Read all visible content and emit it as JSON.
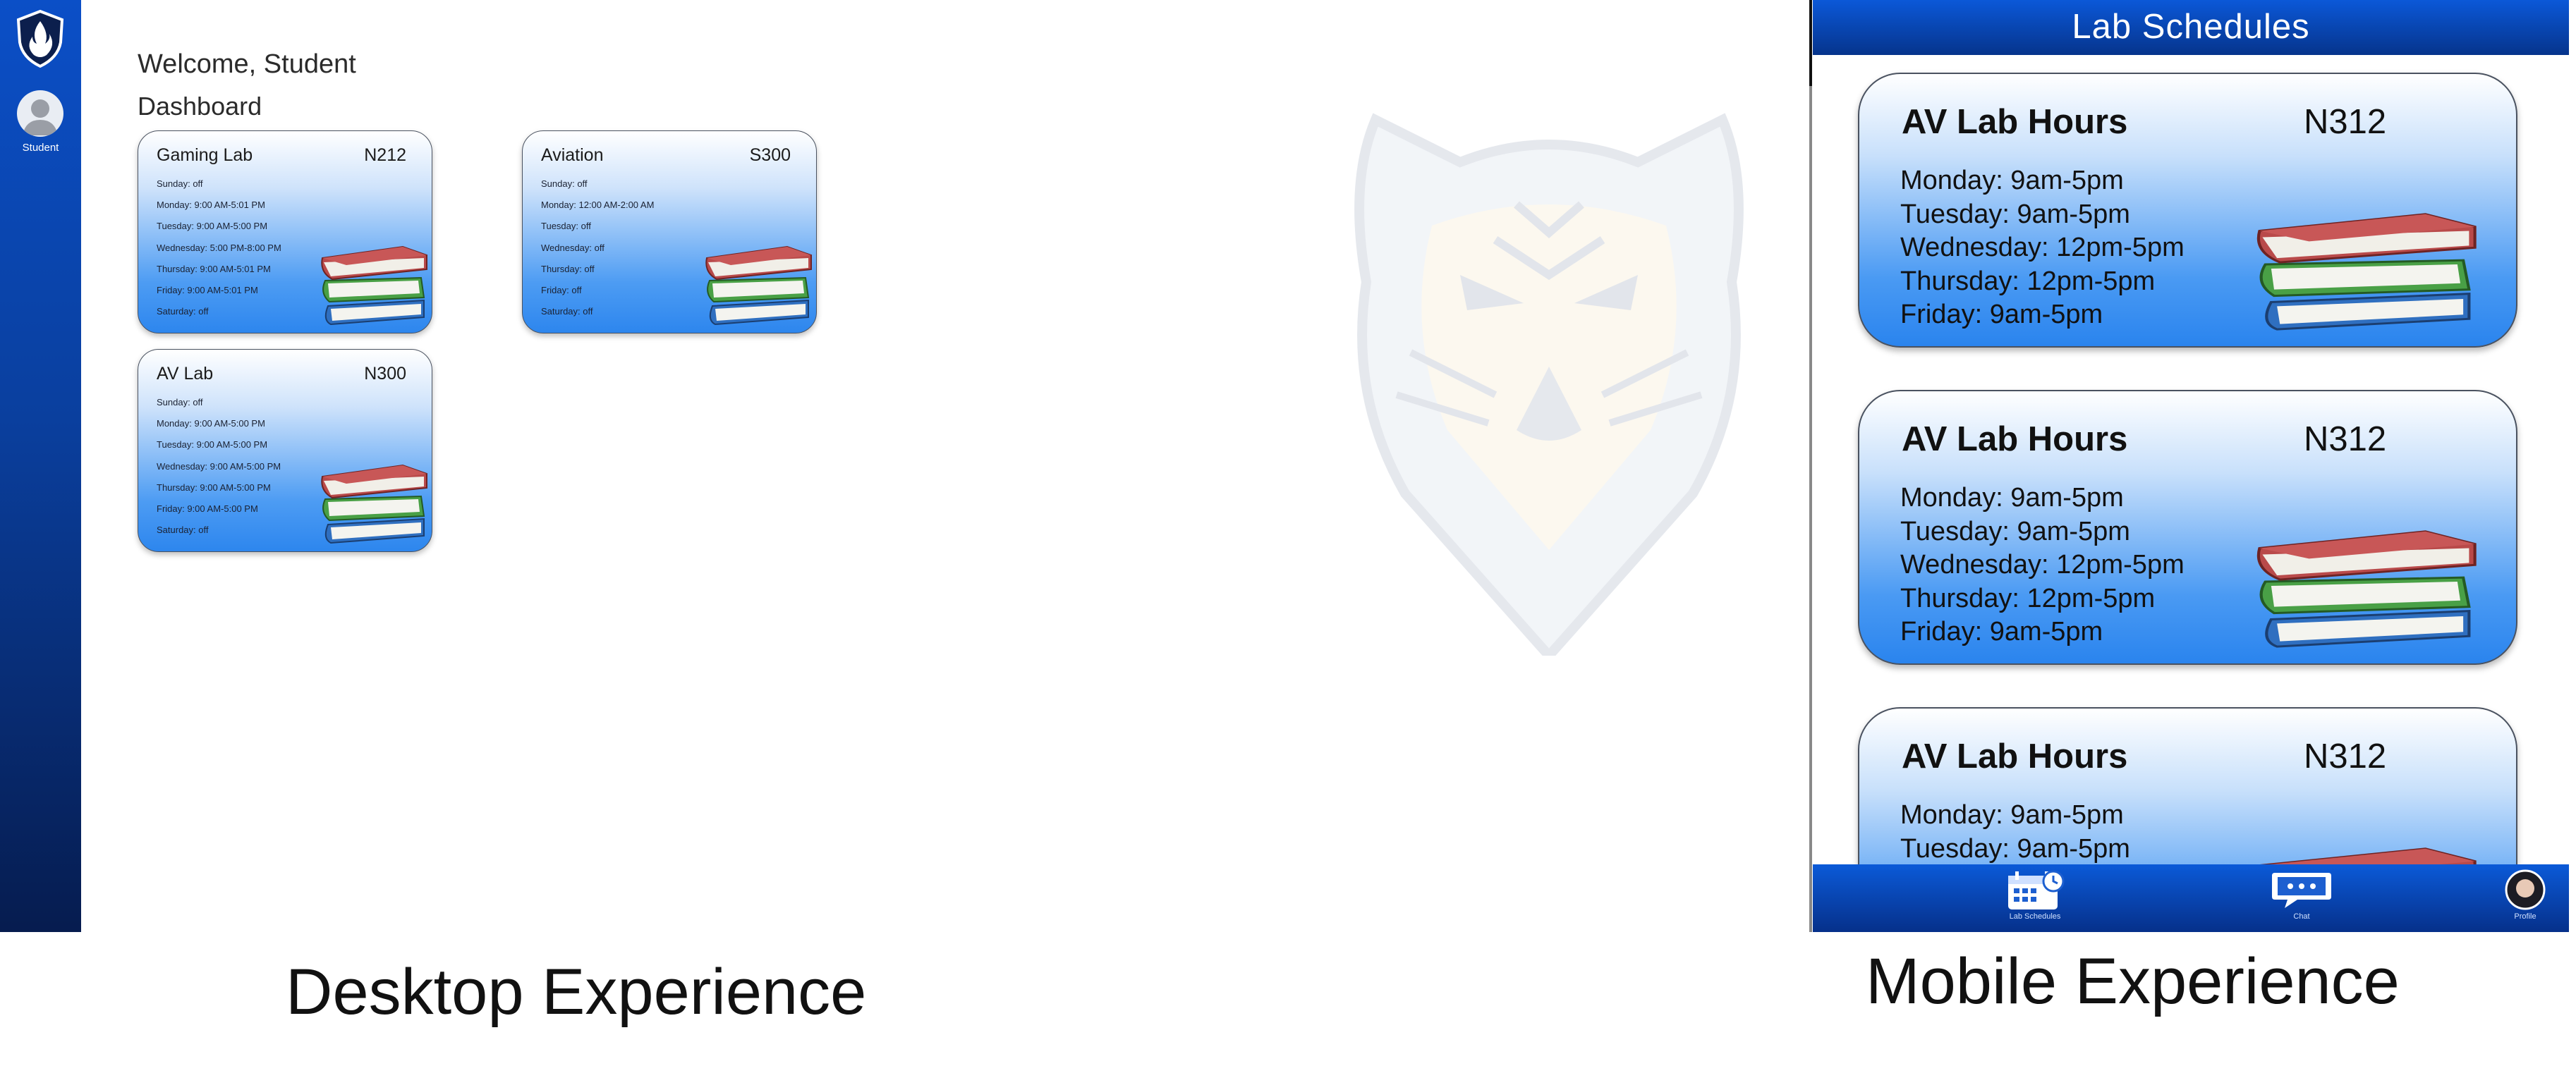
{
  "desktop": {
    "sidebar": {
      "logo_icon": "flame-shield-logo",
      "avatar_icon": "user-avatar-icon",
      "avatar_label": "Student"
    },
    "welcome": "Welcome, Student",
    "section_title": "Dashboard",
    "cards": [
      {
        "name": "Gaming Lab",
        "room": "N212",
        "hours": [
          "Sunday: off",
          "Monday: 9:00 AM-5:01 PM",
          "Tuesday: 9:00 AM-5:00 PM",
          "Wednesday: 5:00 PM-8:00 PM",
          "Thursday: 9:00 AM-5:01 PM",
          "Friday: 9:00 AM-5:01 PM",
          "Saturday: off"
        ]
      },
      {
        "name": "Aviation",
        "room": "S300",
        "hours": [
          "Sunday: off",
          "Monday: 12:00 AM-2:00 AM",
          "Tuesday: off",
          "Wednesday: off",
          "Thursday: off",
          "Friday: off",
          "Saturday: off"
        ]
      },
      {
        "name": "AV Lab",
        "room": "N300",
        "hours": [
          "Sunday: off",
          "Monday: 9:00 AM-5:00 PM",
          "Tuesday: 9:00 AM-5:00 PM",
          "Wednesday: 9:00 AM-5:00 PM",
          "Thursday: 9:00 AM-5:00 PM",
          "Friday: 9:00 AM-5:00 PM",
          "Saturday: off"
        ]
      }
    ],
    "watermark_icon": "tiger-mascot-watermark"
  },
  "mobile": {
    "header_title": "Lab Schedules",
    "cards": [
      {
        "name": "AV Lab Hours",
        "room": "N312",
        "hours": [
          "Monday: 9am-5pm",
          "Tuesday: 9am-5pm",
          "Wednesday: 12pm-5pm",
          "Thursday: 12pm-5pm",
          "Friday: 9am-5pm"
        ]
      },
      {
        "name": "AV Lab Hours",
        "room": "N312",
        "hours": [
          "Monday: 9am-5pm",
          "Tuesday: 9am-5pm",
          "Wednesday: 12pm-5pm",
          "Thursday: 12pm-5pm",
          "Friday: 9am-5pm"
        ]
      },
      {
        "name": "AV Lab Hours",
        "room": "N312",
        "hours": [
          "Monday: 9am-5pm",
          "Tuesday: 9am-5pm"
        ]
      }
    ],
    "tabs": [
      {
        "label": "Lab Schedules",
        "icon": "calendar-clock-icon"
      },
      {
        "label": "Chat",
        "icon": "chat-bubble-icon"
      },
      {
        "label": "Profile",
        "icon": "profile-avatar-icon"
      }
    ]
  },
  "captions": {
    "desktop": "Desktop Experience",
    "mobile": "Mobile Experience"
  },
  "colors": {
    "sidebar_blue": "#0a3f9e",
    "card_blue": "#2d86ee",
    "header_blue": "#0b58d8"
  }
}
